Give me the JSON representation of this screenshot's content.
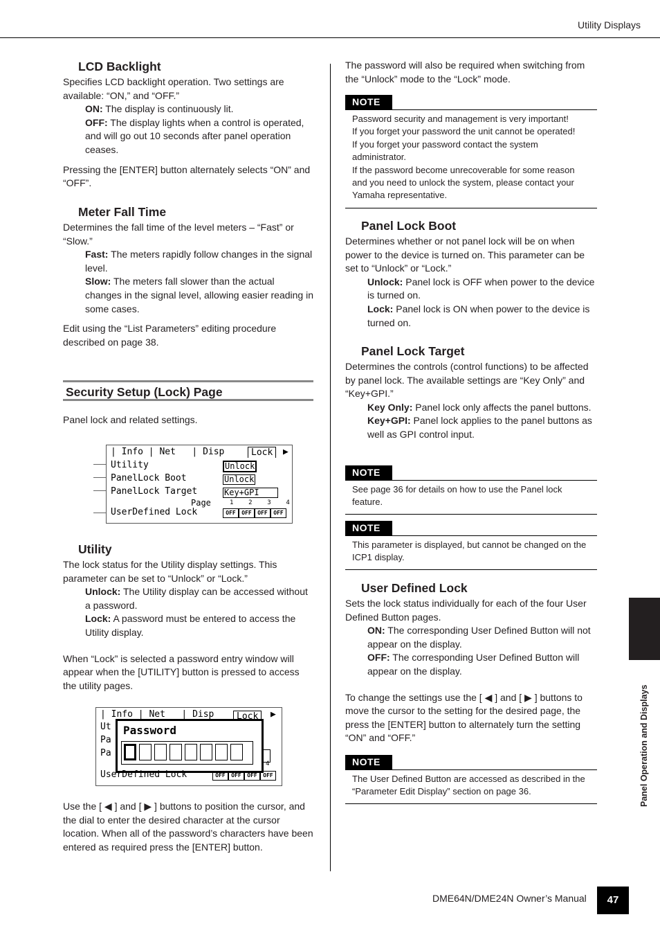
{
  "header": {
    "title": "Utility Displays"
  },
  "footer": {
    "manual": "DME64N/DME24N Owner’s Manual",
    "page": "47"
  },
  "side_tab": {
    "label": "Panel Operation and Displays"
  },
  "left": {
    "lcd_backlight": {
      "heading": "LCD Backlight",
      "intro": "Specifies LCD backlight operation. Two settings are available: “ON,” and “OFF.”",
      "on_term": "ON:",
      "on_text": " The display is continuously lit.",
      "off_term": "OFF:",
      "off_text": " The display lights when a control is operated, and will go out 10 seconds after panel operation ceases.",
      "outro": "Pressing the [ENTER] button alternately selects “ON” and “OFF”."
    },
    "meter_fall": {
      "heading": "Meter Fall Time",
      "intro": "Determines the fall time of the level meters – “Fast” or “Slow.”",
      "fast_term": "Fast:",
      "fast_text": " The meters rapidly follow changes in the signal level.",
      "slow_term": "Slow:",
      "slow_text": " The meters fall slower than the actual changes in the signal level, allowing easier reading in some cases.",
      "outro": "Edit using the “List Parameters” editing procedure described on page 38."
    },
    "security": {
      "heading": "Security Setup (Lock) Page",
      "intro": "Panel lock and related settings."
    },
    "lcd1": {
      "tabs": [
        "Info",
        "Net",
        "Disp",
        "Lock"
      ],
      "rows": [
        "Utility",
        "PanelLock Boot",
        "PanelLock Target"
      ],
      "values": [
        "Unlock",
        "Unlock",
        "Key+GPI"
      ],
      "page_label": "Page",
      "pages": [
        "1",
        "2",
        "3",
        "4"
      ],
      "udl_label": "UserDefined Lock",
      "offs": [
        "OFF",
        "OFF",
        "OFF",
        "OFF"
      ]
    },
    "utility": {
      "heading": "Utility",
      "intro": "The lock status for the Utility display settings. This parameter can be set to “Unlock” or “Lock.”",
      "unlock_term": "Unlock:",
      "unlock_text": " The Utility display can be accessed without a password.",
      "lock_term": "Lock:",
      "lock_text": " A password must be entered to access the Utility display.",
      "para2": "When “Lock” is selected a password entry window will appear when the [UTILITY] button is pressed to access the utility pages."
    },
    "lcd2": {
      "tabs": [
        "Info",
        "Net",
        "Disp",
        "Lock"
      ],
      "partial_rows": [
        "Ut",
        "Pa",
        "Pa"
      ],
      "password_title": "Password",
      "page4": "4",
      "udl_label": "UserDefined Lock",
      "offs": [
        "OFF",
        "OFF",
        "OFF",
        "OFF"
      ]
    },
    "cursor_text": "Use the [ ◀ ] and [ ▶ ] buttons to position the cursor, and the dial to enter the desired character at the cursor location. When all of the password’s characters have been entered as required press the [ENTER] button."
  },
  "right": {
    "intro": "The password will also be required when switching from the “Unlock” mode to the “Lock” mode.",
    "note_label": "NOTE",
    "note1": [
      "Password security and management is very important!",
      "If you forget your password the unit cannot be operated!",
      "If you forget your password contact the system administrator.",
      "If the password become unrecoverable for some reason and you need to unlock the system, please contact your Yamaha representative."
    ],
    "boot": {
      "heading": "Panel Lock Boot",
      "intro": "Determines whether or not panel lock will be on when power to the device is turned on. This parameter can be set to “Unlock” or “Lock.”",
      "unlock_term": "Unlock:",
      "unlock_text": " Panel lock is OFF when power to the device is turned on.",
      "lock_term": "Lock:",
      "lock_text": " Panel lock is ON when power to the device is turned on."
    },
    "target": {
      "heading": "Panel Lock Target",
      "intro": "Determines the controls (control functions) to be affected by panel lock. The available settings are “Key Only” and “Key+GPI.”",
      "key_term": "Key Only:",
      "key_text": " Panel lock only affects the panel buttons.",
      "gpi_term": "Key+GPI:",
      "gpi_text": " Panel lock applies to the panel buttons as well as GPI control input."
    },
    "note2": "See page 36 for details on how to use the Panel lock feature.",
    "note3": "This parameter is displayed, but cannot be changed on the ICP1 display.",
    "udl": {
      "heading": "User Defined Lock",
      "intro": "Sets the lock status individually for each of the four User Defined Button pages.",
      "on_term": "ON:",
      "on_text": " The corresponding User Defined Button will not appear on the display.",
      "off_term": "OFF:",
      "off_text": " The corresponding User Defined Button will appear on the display.",
      "para2": "To change the settings use the [ ◀ ] and [ ▶ ] buttons to move the cursor to the setting for the desired page, the press the [ENTER] button to alternately turn the setting “ON” and “OFF.”"
    },
    "note4": "The User Defined Button are accessed as described in the “Parameter Edit Display” section on page 36."
  }
}
